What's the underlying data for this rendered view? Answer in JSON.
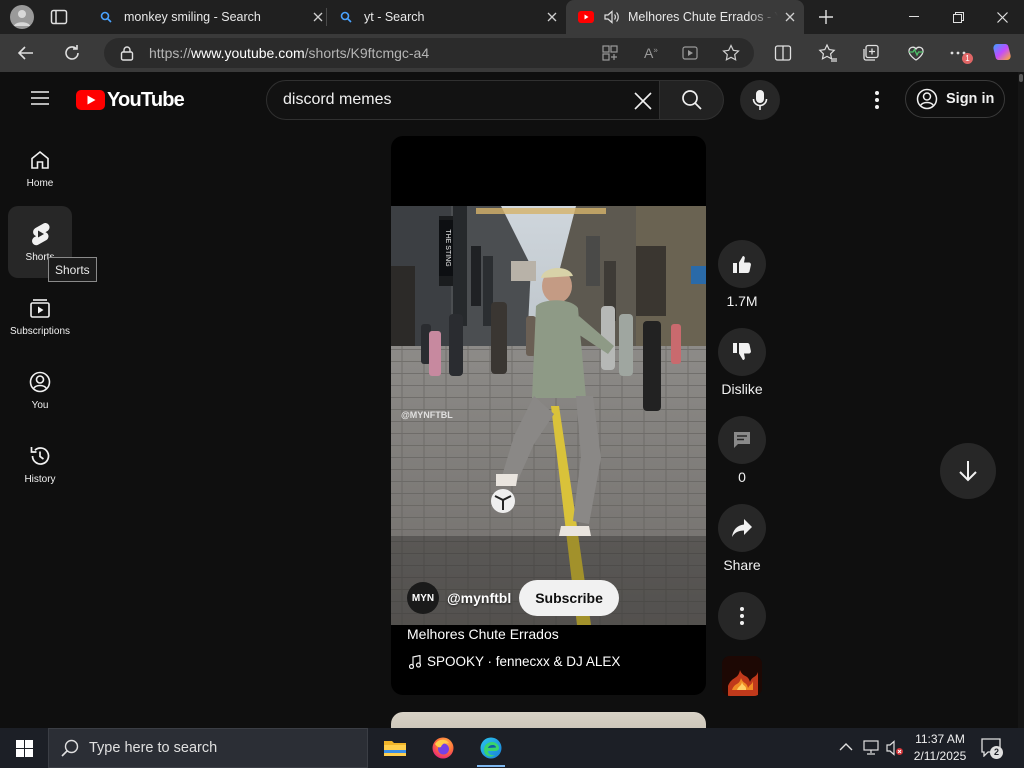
{
  "browser": {
    "tabs": [
      {
        "title": "monkey smiling - Search",
        "icon": "bing-search-icon"
      },
      {
        "title": "yt - Search",
        "icon": "bing-search-icon"
      },
      {
        "title": "Melhores Chute Errados - YouTube",
        "icon": "youtube-icon",
        "audio": "speaker-icon"
      }
    ],
    "new_tab_label": "+",
    "url": {
      "prefix": "https://",
      "host": "www.youtube.com",
      "path": "/shorts/K9ftcmgc-a4"
    },
    "badge_count": "1"
  },
  "youtube": {
    "logo_text": "YouTube",
    "search": {
      "query": "discord memes"
    },
    "sign_in_label": "Sign in",
    "sidebar": [
      {
        "label": "Home",
        "icon": "home-icon"
      },
      {
        "label": "Shorts",
        "icon": "shorts-icon"
      },
      {
        "label": "Subscriptions",
        "icon": "subscriptions-icon"
      },
      {
        "label": "You",
        "icon": "you-icon"
      },
      {
        "label": "History",
        "icon": "history-icon"
      }
    ],
    "tooltip": "Shorts",
    "short": {
      "watermark": "@MYNFTBL",
      "sign_text": "THE STING",
      "channel_avatar": "MYN",
      "channel_handle": "@mynftbl",
      "subscribe_label": "Subscribe",
      "title": "Melhores Chute Errados",
      "song": "SPOOKY · fennecxx & DJ ALEX"
    },
    "actions": {
      "like_count": "1.7M",
      "dislike_label": "Dislike",
      "comment_count": "0",
      "share_label": "Share"
    }
  },
  "taskbar": {
    "search_placeholder": "Type here to search",
    "time": "11:37 AM",
    "date": "2/11/2025",
    "notification_count": "2"
  },
  "colors": {
    "youtube_red": "#ff0000",
    "page_bg": "#0f0f0f",
    "chip_bg": "#272727"
  }
}
